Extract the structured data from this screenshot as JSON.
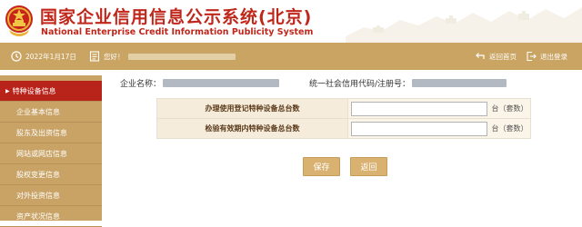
{
  "header": {
    "title_cn": "国家企业信用信息公示系统(北京)",
    "title_en": "National Enterprise Credit Information Publicity System"
  },
  "topbar": {
    "date": "2022年1月17日",
    "greeting": "您好！",
    "back_home": "返回首页",
    "logout": "退出登录"
  },
  "sidebar": {
    "items": [
      {
        "label": "特种设备信息",
        "active": true
      },
      {
        "label": "企业基本信息"
      },
      {
        "label": "股东及出资信息"
      },
      {
        "label": "网站或网店信息"
      },
      {
        "label": "股权变更信息"
      },
      {
        "label": "对外投资信息"
      },
      {
        "label": "资产状况信息"
      }
    ]
  },
  "company": {
    "name_label": "企业名称：",
    "credit_label": "统一社会信用代码/注册号："
  },
  "form": {
    "rows": [
      {
        "label": "办理使用登记特种设备总台数",
        "value": "",
        "unit": "台（套数）"
      },
      {
        "label": "检验有效期内特种设备总台数",
        "value": "",
        "unit": "台（套数）"
      }
    ]
  },
  "buttons": {
    "save": "保存",
    "back": "返回"
  },
  "colors": {
    "brand_red": "#c0271b",
    "gold": "#c9a463",
    "active_red": "#b8231a"
  }
}
